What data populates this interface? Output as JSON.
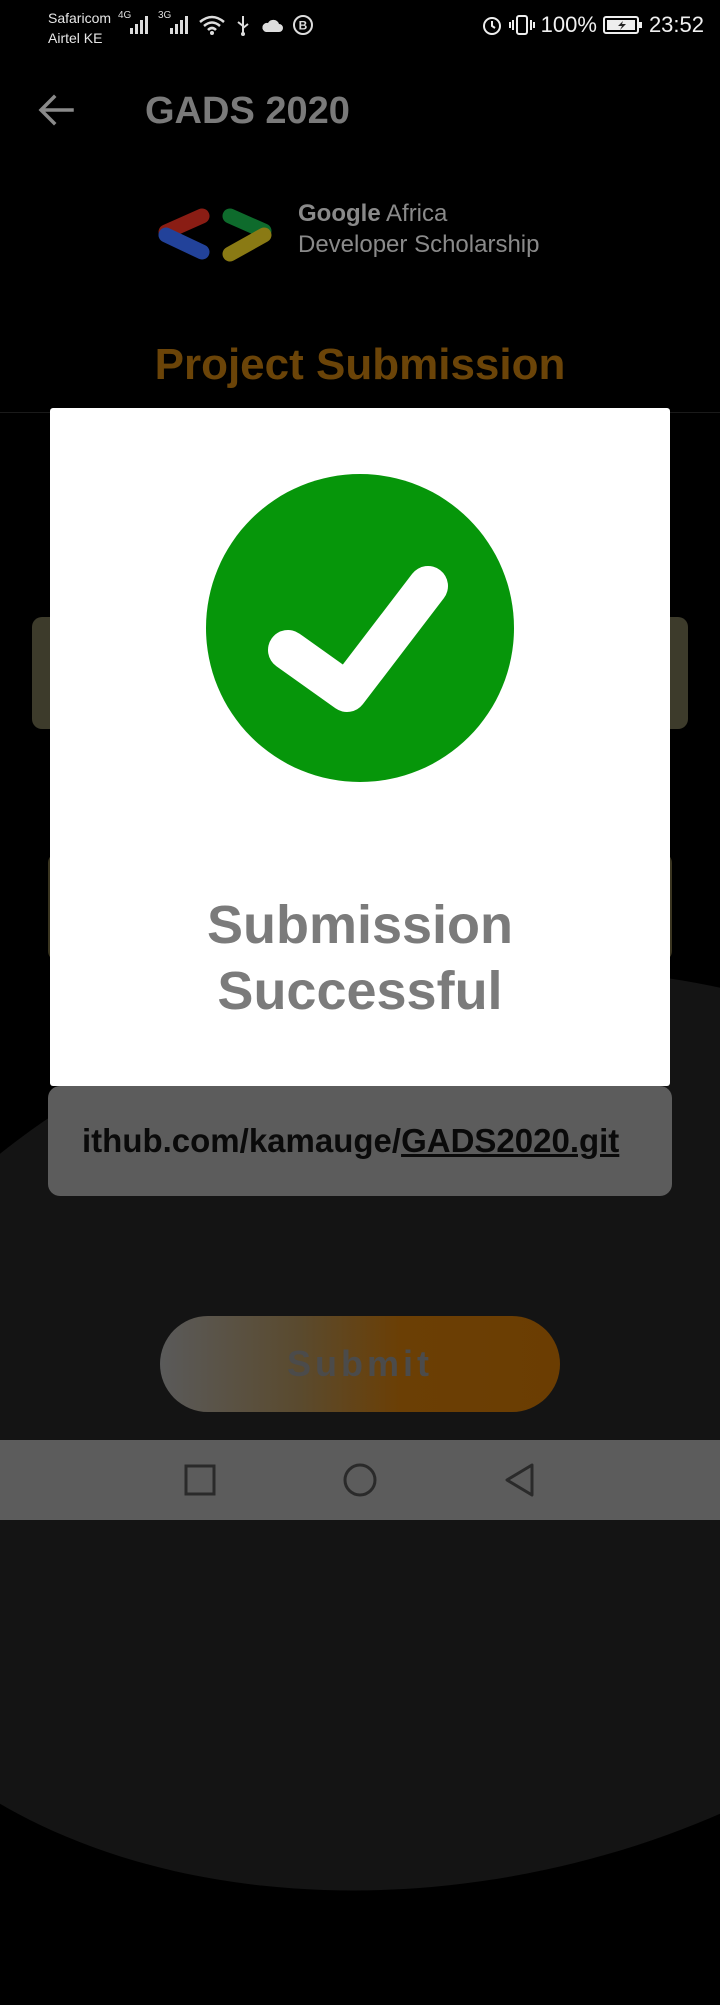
{
  "status_bar": {
    "carrier_1": "Safaricom",
    "carrier_2": "Airtel KE",
    "network_1": "4G",
    "network_2": "3G",
    "battery": "100%",
    "time": "23:52",
    "icons": [
      "signal-icon",
      "wifi-icon",
      "usb-icon",
      "cloud-icon",
      "b-icon",
      "alarm-icon",
      "vibrate-icon",
      "battery-icon"
    ]
  },
  "app_bar": {
    "title": "GADS 2020",
    "back_icon": "arrow-left-icon"
  },
  "logo": {
    "line1_bold": "Google",
    "line1_rest": " Africa",
    "line2": "Developer Scholarship"
  },
  "page": {
    "heading": "Project Submission",
    "github_field_value": "ithub.com/kamauge/",
    "github_field_link": "GADS2020.git",
    "submit_label": "Submit"
  },
  "dialog": {
    "icon": "check-circle-icon",
    "line1": "Submission",
    "line2": "Successful"
  },
  "colors": {
    "success_green": "#06960a",
    "heading_brown": "#6b4408",
    "dialog_text": "#7b7b7b",
    "navbar": "#5c5c5c"
  },
  "nav_bar": {
    "icons": [
      "recents-square-icon",
      "home-circle-icon",
      "back-triangle-icon"
    ]
  }
}
